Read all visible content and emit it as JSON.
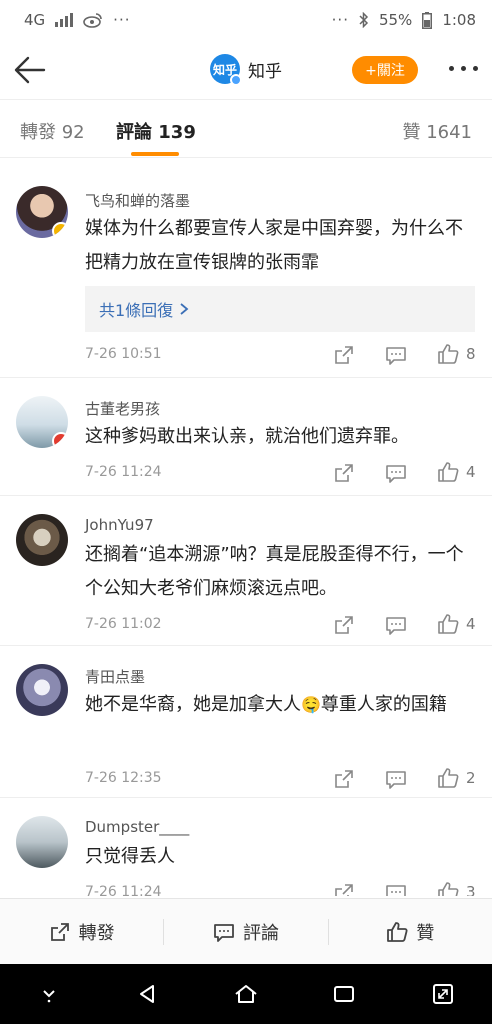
{
  "status_bar": {
    "network": "4G",
    "battery": "55%",
    "time": "1:08"
  },
  "header": {
    "brand_logo_text": "知乎",
    "brand_name": "知乎",
    "follow_label": "+關注"
  },
  "tabs": {
    "repost": "轉發 92",
    "comments": "評論 139",
    "likes": "贊 1641"
  },
  "comments": [
    {
      "user": "飞鸟和蝉的落墨",
      "text": "媒体为什么都要宣传人家是中国弃婴，为什么不把精力放在宣传银牌的张雨霏",
      "reply_label": "共1條回復",
      "time": "7-26 10:51",
      "likes": "8"
    },
    {
      "user": "古董老男孩",
      "text": "这种爹妈敢出来认亲，就治他们遗弃罪。",
      "time": "7-26 11:24",
      "likes": "4"
    },
    {
      "user": "JohnYu97",
      "text": "还搁着“追本溯源”呐？真是屁股歪得不行，一个个公知大老爷们麻烦滚远点吧。",
      "time": "7-26 11:02",
      "likes": "4"
    },
    {
      "user": "青田点墨",
      "text_a": "她不是华裔，她是加拿大人",
      "text_b": "尊重人家的国籍",
      "emoji": "🤤",
      "time": "7-26 12:35",
      "likes": "2"
    },
    {
      "user": "Dumpster____",
      "text": "只觉得丢人",
      "time": "7-26 11:24",
      "likes": "3"
    }
  ],
  "toolbar": {
    "repost": "轉發",
    "comment": "評論",
    "like": "贊"
  },
  "colors": {
    "accent": "#ff8c00",
    "link": "#3b6fb6",
    "brand_blue": "#1e88e5"
  }
}
